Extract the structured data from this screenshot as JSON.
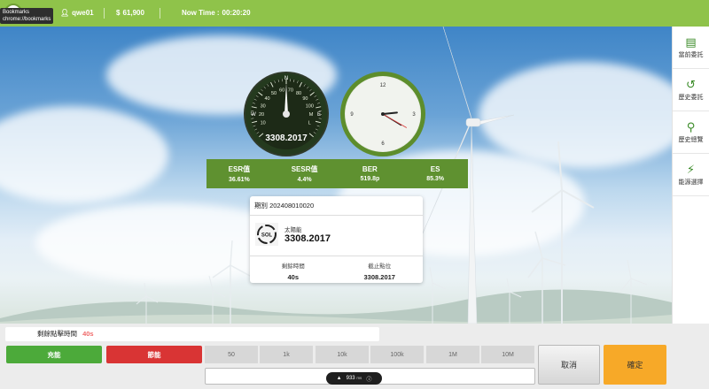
{
  "tooltip": {
    "line1": "Bookmarks",
    "line2": "chrome://bookmarks"
  },
  "header": {
    "username": "qwe01",
    "balance": "61,900",
    "time_label": "Now Time :",
    "time_value": "00:20:20"
  },
  "gauge": {
    "value": "3308.2017",
    "compass": {
      "north": "N",
      "east": "E",
      "west": "W"
    },
    "scale_labels": [
      "10",
      "20",
      "30",
      "40",
      "50",
      "60",
      "70",
      "80",
      "90",
      "100",
      "M",
      "L"
    ]
  },
  "clock": {
    "labels": [
      "12",
      "3",
      "6",
      "9"
    ],
    "time": {
      "hour": 2.8,
      "minute": 20.3,
      "second": 20
    }
  },
  "metrics": [
    {
      "label": "ESR值",
      "value": "36.61%"
    },
    {
      "label": "SESR值",
      "value": "4.4%"
    },
    {
      "label": "BER",
      "value": "519.8p"
    },
    {
      "label": "ES",
      "value": "85.3%"
    }
  ],
  "card": {
    "period_label": "期別",
    "period": "202408010020",
    "logo_text": "SOL",
    "energy_type": "太陽能",
    "value": "3308.2017",
    "remaining_label": "剩餘時間",
    "remaining_value": "40s",
    "cutoff_label": "截止點位",
    "cutoff_value": "3308.2017"
  },
  "sidebar": {
    "items": [
      {
        "label": "當前委託",
        "icon": "clipboard-icon",
        "glyph": "▤"
      },
      {
        "label": "歷史委託",
        "icon": "history-icon",
        "glyph": "↺"
      },
      {
        "label": "歷史總覽",
        "icon": "map-pin-icon",
        "glyph": "⚲"
      },
      {
        "label": "能源選擇",
        "icon": "lightning-icon",
        "glyph": "⚡"
      }
    ]
  },
  "bottom": {
    "countdown_label": "剩餘點擊時間",
    "countdown_value": "40s",
    "charge_label": "充能",
    "save_label": "節能",
    "amounts": [
      "50",
      "1k",
      "10k",
      "100k",
      "1M",
      "10M"
    ],
    "cancel_label": "取消",
    "confirm_label": "確定"
  },
  "perf": {
    "value": "933",
    "unit": "ms"
  },
  "colors": {
    "topbar": "#8fc34a",
    "metric_bar": "#5f9130",
    "charge": "#4caa3a",
    "save": "#d93434",
    "confirm": "#f7a928",
    "countdown_value": "#f06a6a"
  }
}
